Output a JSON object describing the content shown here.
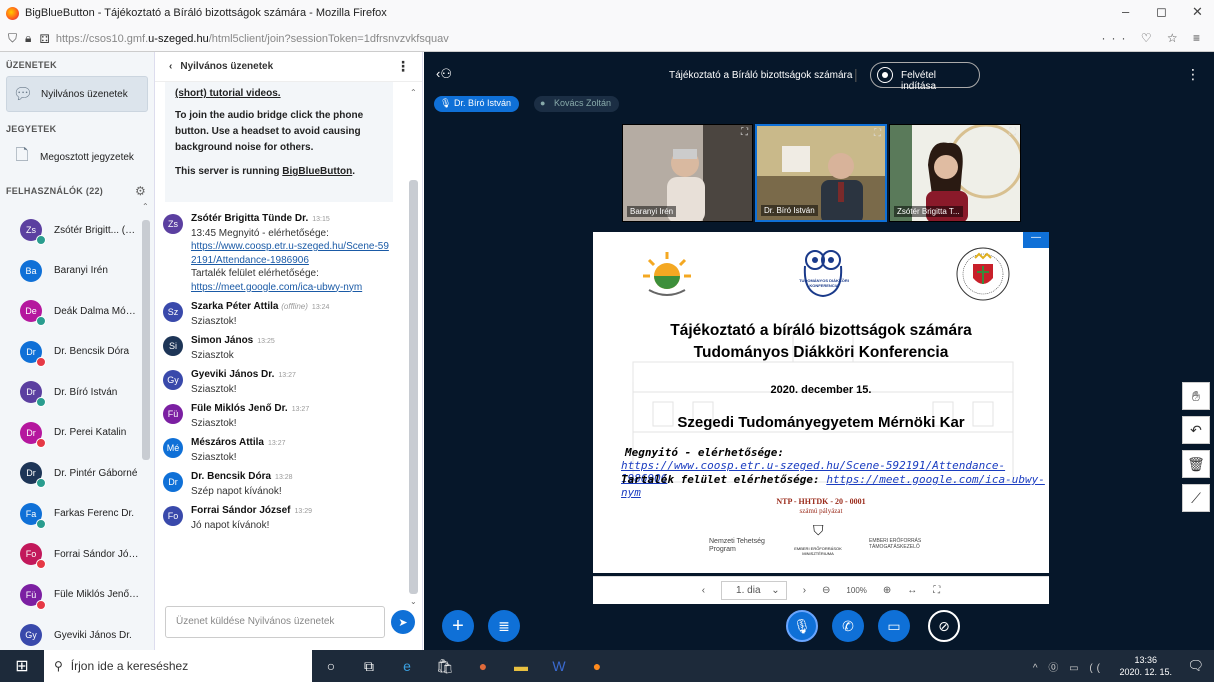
{
  "browser": {
    "title": "BigBlueButton - Tájékoztató a Bíráló bizottságok számára - Mozilla Firefox",
    "url_prefix": "https://csos10.gmf.",
    "url_domain": "u-szeged.hu",
    "url_suffix": "/html5client/join?sessionToken=1dfrsnvzvkfsquav",
    "url_right_icons": "··· ♡ ☆ ≡"
  },
  "left_panel": {
    "messages_section": "ÜZENETEK",
    "public_chat": "Nyilvános üzenetek",
    "notes_section": "JEGYETEK",
    "shared_notes": "Megosztott jegyzetek",
    "users_section": "FELHASZNÁLÓK (22)",
    "users": [
      {
        "initials": "Zs",
        "name": "Zsótér Brigitt... (Én)",
        "color": "#5b3fa0",
        "dot": "#2a9d8f"
      },
      {
        "initials": "Ba",
        "name": "Baranyi Irén",
        "color": "#0f70d7",
        "dot": ""
      },
      {
        "initials": "De",
        "name": "Deák Dalma Móni...",
        "color": "#b5179e",
        "dot": "#2a9d8f"
      },
      {
        "initials": "Dr",
        "name": "Dr. Bencsik Dóra",
        "color": "#0f70d7",
        "dot": "#e63946"
      },
      {
        "initials": "Dr",
        "name": "Dr. Bíró István",
        "color": "#5b3fa0",
        "dot": "#2a9d8f"
      },
      {
        "initials": "Dr",
        "name": "Dr. Perei Katalin",
        "color": "#b5179e",
        "dot": "#e63946"
      },
      {
        "initials": "Dr",
        "name": "Dr. Pintér Gáborné",
        "color": "#1d3557",
        "dot": "#2a9d8f"
      },
      {
        "initials": "Fa",
        "name": "Farkas Ferenc Dr.",
        "color": "#0f70d7",
        "dot": "#2a9d8f"
      },
      {
        "initials": "Fo",
        "name": "Forrai Sándor Józ...",
        "color": "#c2185b",
        "dot": "#e63946"
      },
      {
        "initials": "Fü",
        "name": "Füle Miklós Jenő ...",
        "color": "#7b1fa2",
        "dot": "#e63946"
      },
      {
        "initials": "Gy",
        "name": "Gyeviki János Dr.",
        "color": "#3949ab",
        "dot": ""
      }
    ]
  },
  "chat": {
    "header": "Nyilvános üzenetek",
    "welcome_top": "(short) tutorial videos.",
    "welcome_audio": "To join the audio bridge click the phone button. Use a headset to avoid causing background noise for others.",
    "welcome_server": "This server is running ",
    "welcome_bbb": "BigBlueButton",
    "messages": [
      {
        "initials": "Zs",
        "color": "#5b3fa0",
        "name": "Zsótér Brigitta Tünde Dr.",
        "time": "13:15",
        "lines": [
          "13:45 Megnyitó - elérhetősége:"
        ],
        "link1": "https://www.coosp.etr.u-szeged.hu/Scene-592191/Attendance-1986906",
        "mid": "Tartalék felület elérhetősége:",
        "link2": "https://meet.google.com/ica-ubwy-nym"
      },
      {
        "initials": "Sz",
        "color": "#3949ab",
        "name": "Szarka Péter Attila",
        "offline": "(offline)",
        "time": "13:24",
        "text": "Sziasztok!"
      },
      {
        "initials": "Si",
        "color": "#1d3557",
        "name": "Simon János",
        "time": "13:25",
        "text": "Sziasztok"
      },
      {
        "initials": "Gy",
        "color": "#3949ab",
        "name": "Gyeviki János Dr.",
        "time": "13:27",
        "text": "Sziasztok!"
      },
      {
        "initials": "Fü",
        "color": "#7b1fa2",
        "name": "Füle Miklós Jenő Dr.",
        "time": "13:27",
        "text": "Sziasztok!"
      },
      {
        "initials": "Mé",
        "color": "#0f70d7",
        "name": "Mészáros Attila",
        "time": "13:27",
        "text": "Sziasztok!"
      },
      {
        "initials": "Dr",
        "color": "#0f70d7",
        "name": "Dr. Bencsik Dóra",
        "time": "13:28",
        "text": "Szép napot kívánok!"
      },
      {
        "initials": "Fo",
        "color": "#3949ab",
        "name": "Forrai Sándor József",
        "time": "13:29",
        "text": "Jó napot kívánok!"
      }
    ],
    "composer_placeholder": "Üzenet küldése Nyilvános üzenetek"
  },
  "main": {
    "title": "Tájékoztató a Bíráló bizottságok számára",
    "record": "Felvétel indítása",
    "talkers": [
      {
        "name": "Dr. Bíró István"
      },
      {
        "name": "Kovács Zoltán"
      }
    ],
    "videos": [
      {
        "label": "Baranyi Irén"
      },
      {
        "label": "Dr. Bíró István"
      },
      {
        "label": "Zsótér Brigitta T..."
      }
    ],
    "slide": {
      "logo_text": "TUDOMÁNYOS DIÁKKÖRI KONFERENCIA",
      "h1": "Tájékoztató a bíráló bizottságok számára",
      "h2": "Tudományos Diákköri Konferencia",
      "date": "2020. december 15.",
      "faculty": "Szegedi Tudományegyetem Mérnöki Kar",
      "open_label": "Megnyitó - elérhetősége:",
      "open_link": "https://www.coosp.etr.u-szeged.hu/Scene-592191/Attendance-1986906",
      "backup_label": "Tartalék felület elérhetősége: ",
      "backup_link": "https://meet.google.com/ica-ubwy-nym",
      "ntp1": "NTP - HHTDK - 20 - 0001",
      "ntp2": "számú pályázat",
      "footer1": "Nemzeti Tehetség Program",
      "footer2": "EMBERI ERŐFORRÁSOK MINISZTÉRIUMA",
      "footer3": "EMBERI ERŐFORRÁS TÁMOGATÁSKEZELŐ"
    },
    "slide_page": "1. dia",
    "zoom": "100%"
  },
  "taskbar": {
    "search": "Írjon ide a kereséshez",
    "time": "13:36",
    "date": "2020. 12. 15."
  }
}
